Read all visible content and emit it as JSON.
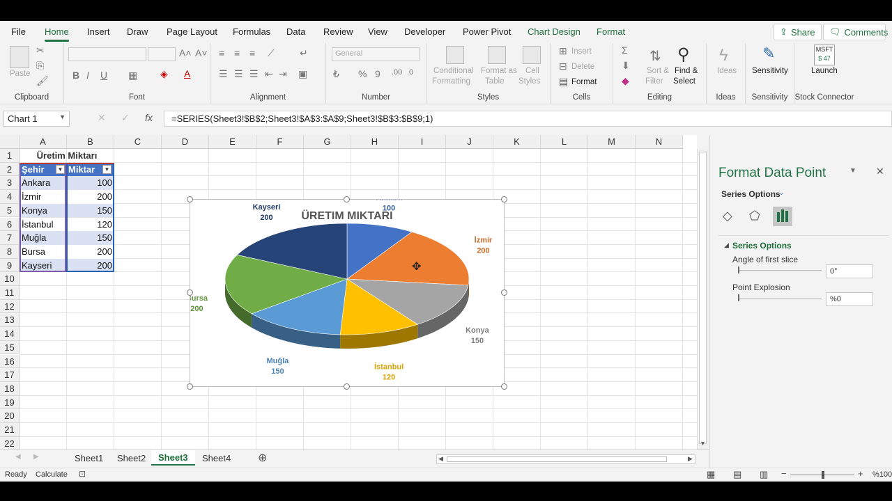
{
  "tabs": [
    "File",
    "Home",
    "Insert",
    "Draw",
    "Page Layout",
    "Formulas",
    "Data",
    "Review",
    "View",
    "Developer",
    "Power Pivot",
    "Chart Design",
    "Format"
  ],
  "top": {
    "share": "Share",
    "comments": "Comments"
  },
  "ribbon": {
    "clipboard": {
      "label": "Clipboard",
      "paste": "Paste"
    },
    "font": {
      "label": "Font"
    },
    "alignment": {
      "label": "Alignment"
    },
    "number": {
      "label": "Number",
      "format": "General"
    },
    "styles": {
      "label": "Styles",
      "cond1": "Conditional",
      "cond2": "Formatting",
      "fmt1": "Format as",
      "fmt2": "Table",
      "cell1": "Cell",
      "cell2": "Styles"
    },
    "cells": {
      "label": "Cells",
      "insert": "Insert",
      "delete": "Delete",
      "format": "Format"
    },
    "editing": {
      "label": "Editing",
      "sort1": "Sort &",
      "sort2": "Filter",
      "find1": "Find &",
      "find2": "Select"
    },
    "ideas": {
      "label": "Ideas",
      "btn": "Ideas"
    },
    "sensitivity": {
      "label": "Sensitivity",
      "btn": "Sensitivity"
    },
    "stock": {
      "label": "Stock Connector",
      "btn": "Launch",
      "ticker": "MSFT",
      "price": "$ 47"
    }
  },
  "formula_bar": {
    "name_box": "Chart 1",
    "formula": "=SERIES(Sheet3!$B$2;Sheet3!$A$3:$A$9;Sheet3!$B$3:$B$9;1)"
  },
  "columns": [
    "A",
    "B",
    "C",
    "D",
    "E",
    "F",
    "G",
    "H",
    "I",
    "J",
    "K",
    "L",
    "M",
    "N"
  ],
  "rows": [
    "1",
    "2",
    "3",
    "4",
    "5",
    "6",
    "7",
    "8",
    "9",
    "10",
    "11",
    "12",
    "13",
    "14",
    "15",
    "16",
    "17",
    "18",
    "19",
    "20",
    "21",
    "22"
  ],
  "table": {
    "title": "Üretim Miktarı",
    "headers": [
      "Şehir",
      "Miktar"
    ],
    "rows": [
      [
        "Ankara",
        "100"
      ],
      [
        "İzmir",
        "200"
      ],
      [
        "Konya",
        "150"
      ],
      [
        "İstanbul",
        "120"
      ],
      [
        "Muğla",
        "150"
      ],
      [
        "Bursa",
        "200"
      ],
      [
        "Kayseri",
        "200"
      ]
    ]
  },
  "chart_data": {
    "type": "pie",
    "title": "ÜRETIM MIKTARI",
    "categories": [
      "Ankara",
      "İzmir",
      "Konya",
      "İstanbul",
      "Muğla",
      "Bursa",
      "Kayseri"
    ],
    "values": [
      100,
      200,
      150,
      120,
      150,
      200,
      200
    ],
    "labels": [
      "100",
      "200",
      "150",
      "120",
      "150",
      "200",
      "200"
    ],
    "colors": [
      "#4472c4",
      "#ed7d31",
      "#a5a5a5",
      "#ffc000",
      "#5b9bd5",
      "#70ad47",
      "#264478"
    ]
  },
  "pane": {
    "title": "Format Data Point",
    "series_options": "Series Options",
    "section": "Series Options",
    "angle_label": "Angle of first slice",
    "angle_value": "0°",
    "explosion_label": "Point Explosion",
    "explosion_value": "%0"
  },
  "sheets": [
    "Sheet1",
    "Sheet2",
    "Sheet3",
    "Sheet4"
  ],
  "status": {
    "ready": "Ready",
    "calc": "Calculate",
    "zoom": "%100"
  }
}
